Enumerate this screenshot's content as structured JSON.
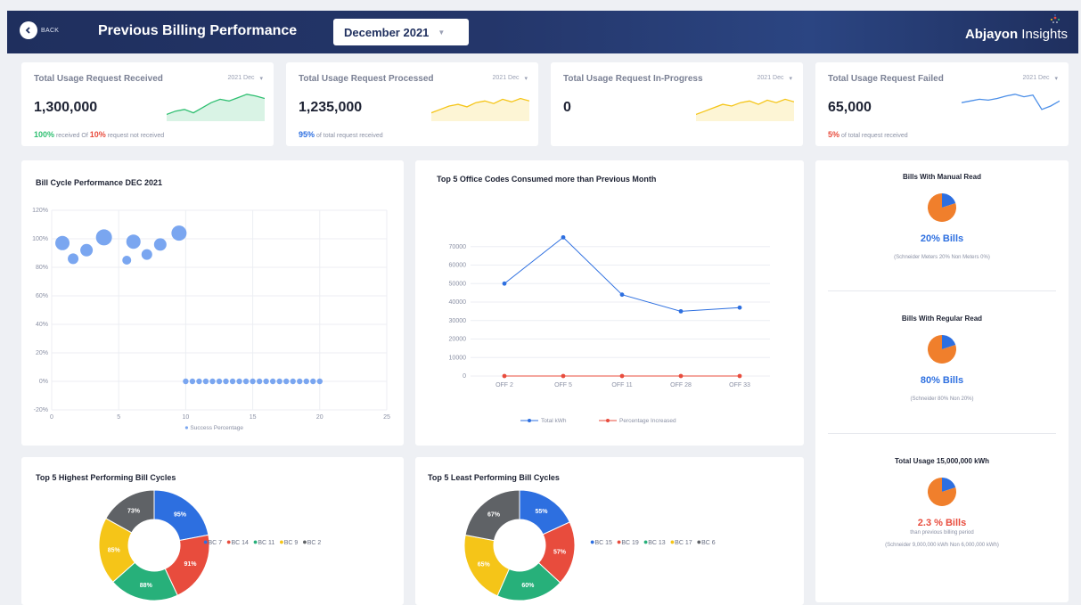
{
  "header": {
    "back_label": "BACK",
    "title": "Previous Billing Performance",
    "month": "December 2021",
    "brand_bold": "Abjayon",
    "brand_light": " Insights"
  },
  "kpis": [
    {
      "title": "Total Usage Request Received",
      "filter": "2021 Dec",
      "value": "1,300,000",
      "foot": [
        {
          "text": "100%",
          "cls": "green"
        },
        {
          "text": " received  Of  ",
          "cls": ""
        },
        {
          "text": "10%",
          "cls": "red"
        },
        {
          "text": " request not received",
          "cls": ""
        }
      ],
      "spark_color": "#2fbf71",
      "spark": [
        8,
        12,
        14,
        10,
        16,
        22,
        26,
        24,
        28,
        32,
        30,
        27
      ]
    },
    {
      "title": "Total Usage Request Processed",
      "filter": "2021 Dec",
      "value": "1,235,000",
      "foot": [
        {
          "text": "95%",
          "cls": "blue"
        },
        {
          "text": " of total request received",
          "cls": ""
        }
      ],
      "spark_color": "#f5c518",
      "spark": [
        10,
        14,
        18,
        20,
        17,
        22,
        24,
        21,
        26,
        23,
        27,
        24
      ]
    },
    {
      "title": "Total Usage Request In-Progress",
      "filter": "2021 Dec",
      "value": "0",
      "foot": [],
      "spark_color": "#f5c518",
      "spark": [
        8,
        12,
        16,
        20,
        18,
        22,
        24,
        20,
        25,
        22,
        26,
        23
      ]
    },
    {
      "title": "Total Usage Request Failed",
      "filter": "2021 Dec",
      "value": "65,000",
      "foot": [
        {
          "text": "5%",
          "cls": "red"
        },
        {
          "text": " of total request received",
          "cls": ""
        }
      ],
      "spark_color": "#4c8fe8",
      "spark": [
        22,
        24,
        26,
        25,
        27,
        30,
        32,
        29,
        31,
        14,
        18,
        24
      ]
    }
  ],
  "colors": {
    "orange": "#f07f2c",
    "blue": "#2d6fe0",
    "red_line": "#e84c3d",
    "scatter": "#7aa6f0"
  },
  "chart_data": [
    {
      "type": "scatter",
      "title": "Bill Cycle Performance DEC 2021",
      "xlim": [
        0,
        25
      ],
      "ylim": [
        -20,
        120
      ],
      "x_ticks": [
        "0",
        "5",
        "10",
        "15",
        "20",
        "25"
      ],
      "y_ticks": [
        "-20%",
        "0%",
        "20%",
        "40%",
        "60%",
        "80%",
        "100%",
        "120%"
      ],
      "legend": "Success Percentage",
      "series": [
        {
          "points": [
            {
              "x": 0.8,
              "y": 97,
              "r": 8
            },
            {
              "x": 1.6,
              "y": 86,
              "r": 6
            },
            {
              "x": 2.6,
              "y": 92,
              "r": 7
            },
            {
              "x": 3.9,
              "y": 101,
              "r": 9
            },
            {
              "x": 5.6,
              "y": 85,
              "r": 5
            },
            {
              "x": 6.1,
              "y": 98,
              "r": 8
            },
            {
              "x": 7.1,
              "y": 89,
              "r": 6
            },
            {
              "x": 8.1,
              "y": 96,
              "r": 7
            },
            {
              "x": 9.5,
              "y": 104,
              "r": 8.5
            },
            {
              "x": 10,
              "y": 0,
              "r": 3.2
            },
            {
              "x": 10.5,
              "y": 0,
              "r": 3.2
            },
            {
              "x": 11,
              "y": 0,
              "r": 3.2
            },
            {
              "x": 11.5,
              "y": 0,
              "r": 3.2
            },
            {
              "x": 12,
              "y": 0,
              "r": 3.2
            },
            {
              "x": 12.5,
              "y": 0,
              "r": 3.2
            },
            {
              "x": 13,
              "y": 0,
              "r": 3.2
            },
            {
              "x": 13.5,
              "y": 0,
              "r": 3.2
            },
            {
              "x": 14,
              "y": 0,
              "r": 3.2
            },
            {
              "x": 14.5,
              "y": 0,
              "r": 3.2
            },
            {
              "x": 15,
              "y": 0,
              "r": 3.2
            },
            {
              "x": 15.5,
              "y": 0,
              "r": 3.2
            },
            {
              "x": 16,
              "y": 0,
              "r": 3.2
            },
            {
              "x": 16.5,
              "y": 0,
              "r": 3.2
            },
            {
              "x": 17,
              "y": 0,
              "r": 3.2
            },
            {
              "x": 17.5,
              "y": 0,
              "r": 3.2
            },
            {
              "x": 18,
              "y": 0,
              "r": 3.2
            },
            {
              "x": 18.5,
              "y": 0,
              "r": 3.2
            },
            {
              "x": 19,
              "y": 0,
              "r": 3.2
            },
            {
              "x": 19.5,
              "y": 0,
              "r": 3.2
            },
            {
              "x": 20,
              "y": 0,
              "r": 3.2
            }
          ]
        }
      ]
    },
    {
      "type": "line",
      "title": "Top 5 Office Codes Consumed more than Previous Month",
      "categories": [
        "OFF 2",
        "OFF 5",
        "OFF 11",
        "OFF 28",
        "OFF 33"
      ],
      "ylim": [
        0,
        80000
      ],
      "y_ticks": [
        "0",
        "10000",
        "20000",
        "30000",
        "40000",
        "50000",
        "60000",
        "70000"
      ],
      "series": [
        {
          "name": "Total kWh",
          "color": "#2d6fe0",
          "values": [
            50000,
            75000,
            44000,
            35000,
            37000
          ]
        },
        {
          "name": "Percentage Increased",
          "color": "#e84c3d",
          "values": [
            0,
            0,
            0,
            0,
            0
          ]
        }
      ]
    },
    {
      "type": "pie",
      "title": "Top 5 Highest Performing Bill Cycles",
      "labels": [
        "BC 7",
        "BC 14",
        "BC 11",
        "BC 9",
        "BC 2"
      ],
      "values": [
        95,
        91,
        88,
        85,
        73
      ],
      "colors": [
        "#2d6fe0",
        "#e84c3d",
        "#27b07a",
        "#f5c518",
        "#5f6266"
      ]
    },
    {
      "type": "pie",
      "title": "Top 5 Least Performing Bill Cycles",
      "labels": [
        "BC 15",
        "BC 19",
        "BC 13",
        "BC 17",
        "BC 6"
      ],
      "values": [
        55,
        57,
        60,
        65,
        67
      ],
      "colors": [
        "#2d6fe0",
        "#e84c3d",
        "#27b07a",
        "#f5c518",
        "#5f6266"
      ]
    },
    {
      "type": "pie",
      "title": "Bills With Manual Read",
      "values": [
        20,
        80
      ],
      "colors": [
        "#2d6fe0",
        "#f07f2c"
      ]
    },
    {
      "type": "pie",
      "title": "Bills With Regular Read",
      "values": [
        20,
        80
      ],
      "colors": [
        "#2d6fe0",
        "#f07f2c"
      ]
    },
    {
      "type": "pie",
      "title": "Total Usage 15,000,000 kWh",
      "values": [
        20,
        80
      ],
      "colors": [
        "#2d6fe0",
        "#f07f2c"
      ]
    }
  ],
  "side": {
    "manual": {
      "title": "Bills With Manual Read",
      "big": "20% Bills",
      "note": "(Schneider Meters 20%  Non Meters 0%)"
    },
    "regular": {
      "title": "Bills With Regular Read",
      "big": "80% Bills",
      "note": "(Schneider 80%  Non 20%)"
    },
    "usage": {
      "title": "Total Usage 15,000,000 kWh",
      "big": "2.3 % Bills",
      "sub": "than previous billing period",
      "note": "(Schneider 9,000,000 kWh   Non 6,000,000 kWh)"
    }
  }
}
